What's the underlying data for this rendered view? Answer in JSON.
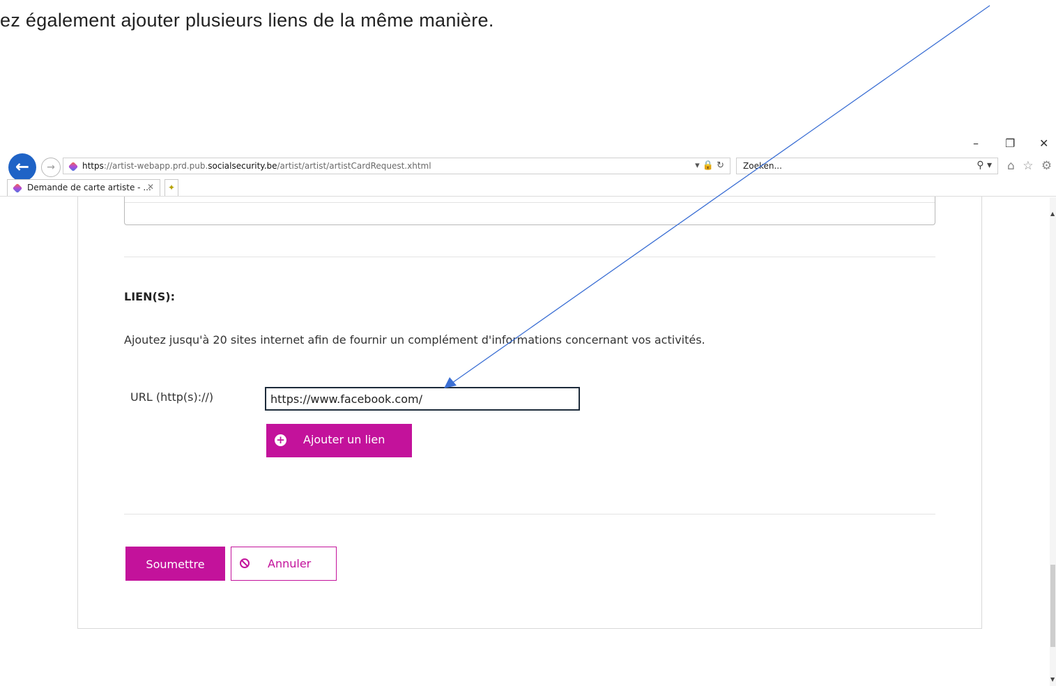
{
  "document": {
    "instruction_text": "ez également ajouter plusieurs liens de la même manière."
  },
  "window_controls": {
    "minimize": "–",
    "restore": "❐",
    "close": "✕"
  },
  "browser": {
    "back_glyph": "←",
    "forward_glyph": "→",
    "url_scheme": "https",
    "url_prefix": "://artist-webapp.prd.pub.",
    "url_domain": "socialsecurity.be",
    "url_path": "/artist/artist/artistCardRequest.xhtml",
    "address_tools": "▾ 🔒 ↻",
    "search_placeholder": "Zoeken...",
    "search_tools": "⚲ ▾",
    "nav_icons": "⌂ ☆ ⚙",
    "tab_title": "Demande de carte artiste - ...",
    "tab_close": "✕",
    "new_tab_glyph": "✦"
  },
  "form": {
    "section_title": "LIEN(S):",
    "help_text": "Ajoutez jusqu'à 20 sites internet afin de fournir un complément d'informations concernant vos activités.",
    "url_label": "URL (http(s)://)",
    "url_value": "https://www.facebook.com/",
    "add_link_label": "Ajouter un lien",
    "add_link_icon": "+",
    "submit_label": "Soumettre",
    "cancel_label": "Annuler"
  },
  "scrollbar": {
    "up_glyph": "▲",
    "down_glyph": "▼"
  },
  "colors": {
    "brand_magenta": "#c3129b",
    "back_button_blue": "#1f63c6",
    "annotation_arrow": "#3b6fd4"
  }
}
